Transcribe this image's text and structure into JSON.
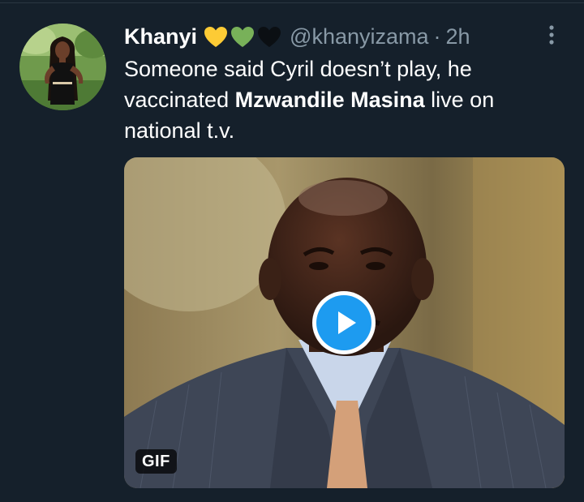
{
  "tweet": {
    "display_name": "Khanyi",
    "emojis": [
      "yellow-heart",
      "green-heart",
      "black-heart"
    ],
    "handle": "@khanyizama",
    "separator": "·",
    "timestamp": "2h",
    "text": {
      "part1": "Someone said Cyril doesn’t play, he vaccinated ",
      "bold": "Mzwandile Masina",
      "part2": " live on national t.v."
    },
    "media": {
      "badge": "GIF"
    }
  },
  "colors": {
    "background": "#15202b",
    "text": "#ffffff",
    "secondary_text": "#8899a6",
    "accent": "#1d9bf0"
  }
}
